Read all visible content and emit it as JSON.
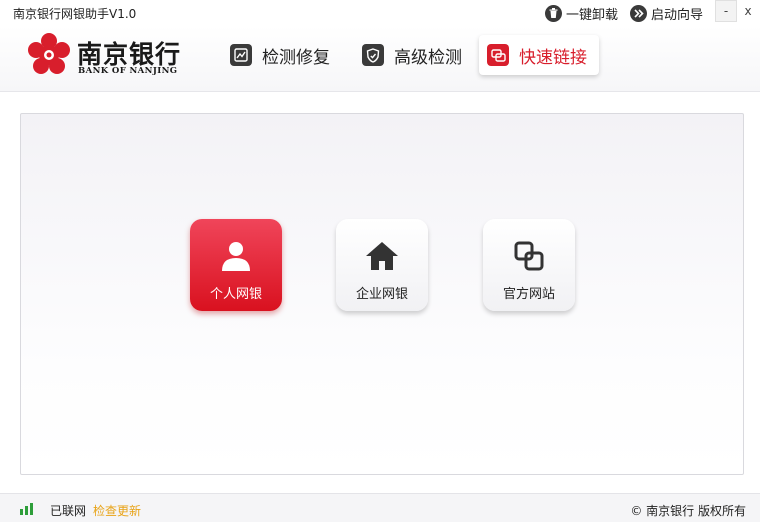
{
  "window": {
    "title": "南京银行网银助手V1.0",
    "uninstall_label": "一键卸载",
    "guide_label": "启动向导",
    "minimize_glyph": "-",
    "close_glyph": "x"
  },
  "brand": {
    "name": "南京银行",
    "english": "BANK OF NANJING",
    "color": "#d81e2c"
  },
  "nav": {
    "tabs": [
      {
        "label": "检测修复",
        "icon": "image-check-icon",
        "active": false
      },
      {
        "label": "高级检测",
        "icon": "shield-icon",
        "active": false
      },
      {
        "label": "快速链接",
        "icon": "link-icon",
        "active": true
      }
    ]
  },
  "tiles": [
    {
      "label": "个人网银",
      "icon": "person-icon",
      "style": "red"
    },
    {
      "label": "企业网银",
      "icon": "home-icon",
      "style": "white"
    },
    {
      "label": "官方网站",
      "icon": "squares-link-icon",
      "style": "white"
    }
  ],
  "status": {
    "network": "已联网",
    "check_update": "检查更新",
    "copyright": "© 南京银行 版权所有",
    "signal_color": "#2e9e3a",
    "update_color": "#e8a317"
  }
}
